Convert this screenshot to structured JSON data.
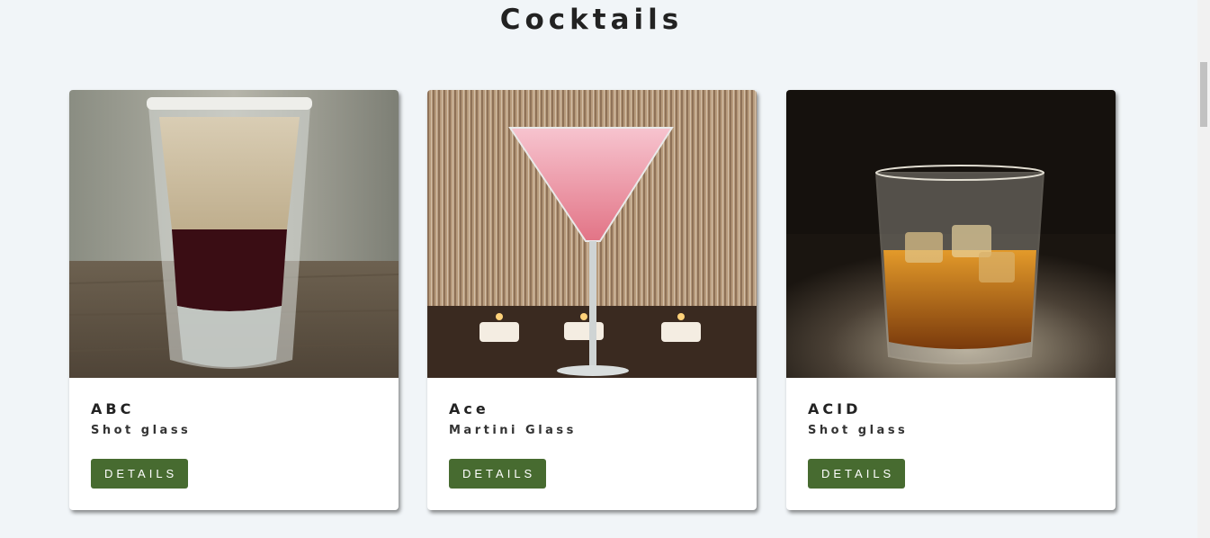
{
  "page": {
    "title": "Cocktails"
  },
  "cocktails": [
    {
      "name": "ABC",
      "glass": "Shot glass",
      "button": "DETAILS",
      "photo": "layered-shot-glass"
    },
    {
      "name": "Ace",
      "glass": "Martini Glass",
      "button": "DETAILS",
      "photo": "pink-martini"
    },
    {
      "name": "ACID",
      "glass": "Shot glass",
      "button": "DETAILS",
      "photo": "whiskey-on-rocks"
    }
  ],
  "colors": {
    "background": "#f1f5f8",
    "button": "#476b30",
    "card": "#ffffff"
  }
}
